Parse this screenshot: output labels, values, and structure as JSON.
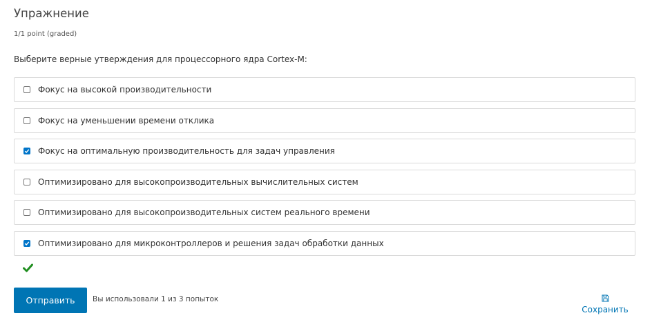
{
  "problem": {
    "title": "Упражнение",
    "points": "1/1 point (graded)",
    "question": "Выберите верные утверждения для процессорного ядра Cortex-M:"
  },
  "options": [
    {
      "label": "Фокус на высокой производительности",
      "checked": false
    },
    {
      "label": "Фокус на уменьшении времени отклика",
      "checked": false
    },
    {
      "label": "Фокус на оптимальную производительность для задач управления",
      "checked": true
    },
    {
      "label": "Оптимизировано для высокопроизводительных вычислительных систем",
      "checked": false
    },
    {
      "label": "Оптимизировано для высокопроизводительных систем реального времени",
      "checked": false
    },
    {
      "label": "Оптимизировано для микроконтроллеров и решения задач обработки данных",
      "checked": true
    }
  ],
  "status": {
    "icon": "checkmark-icon",
    "color": "#1f8e1f"
  },
  "actions": {
    "submit_label": "Отправить",
    "attempts_text": "Вы использовали 1 из 3 попыток",
    "save_label": "Сохранить",
    "save_icon": "floppy-disk-icon"
  },
  "colors": {
    "accent": "#0075b4",
    "checkbox_checked": "#0075c9",
    "border": "#d9d9d9"
  }
}
